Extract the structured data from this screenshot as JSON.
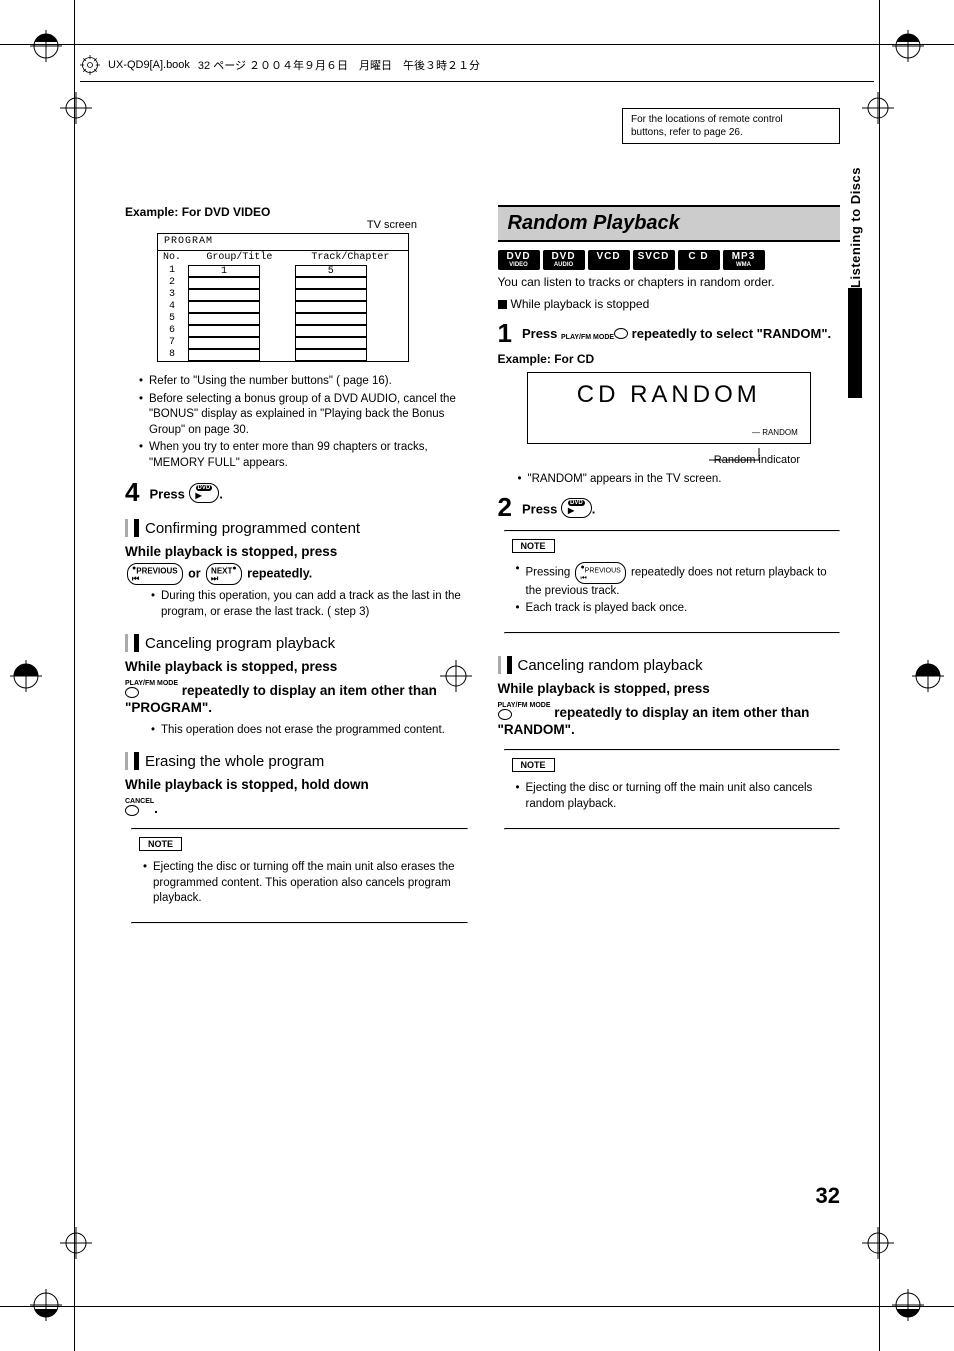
{
  "book_header": {
    "filename": "UX-QD9[A].book",
    "page_text": "32 ページ ２００４年９月６日　月曜日　午後３時２１分"
  },
  "ref_box": {
    "line1": "For the locations of remote control",
    "line2": "buttons, refer to page 26."
  },
  "side_tab": "Listening to Discs",
  "left": {
    "example_label": "Example: For DVD VIDEO",
    "tv_screen": "TV screen",
    "program_title": "PROGRAM",
    "cols": {
      "no": "No.",
      "group": "Group/Title",
      "track": "Track/Chapter"
    },
    "first_group": "1",
    "first_track": "5",
    "rows": [
      "1",
      "2",
      "3",
      "4",
      "5",
      "6",
      "7",
      "8"
    ],
    "bullets": [
      "Refer to \"Using the number buttons\" (       page 16).",
      "Before selecting a bonus group of a DVD AUDIO, cancel the \"BONUS\" display as explained in \"Playing back the Bonus Group\" on page 30.",
      "When you try to enter more than 99 chapters or tracks, \"MEMORY FULL\" appears."
    ],
    "step4": {
      "num": "4",
      "text_a": "Press ",
      "text_b": "."
    },
    "confirm_heading": "Confirming programmed content",
    "confirm_line1": "While playback is stopped, press",
    "confirm_line2a": " or ",
    "confirm_line2b": " repeatedly.",
    "confirm_sub": "During this operation, you can add a track as the last in the program, or erase the last track. (       step 3)",
    "cancel_heading": "Canceling program playback",
    "cancel_line1": "While playback is stopped, press",
    "cancel_line2": " repeatedly to display an item other than \"PROGRAM\".",
    "cancel_sub": "This operation does not erase the programmed content.",
    "erase_heading": "Erasing the whole program",
    "erase_line1": "While playback is stopped, hold down",
    "erase_line2": ".",
    "note1": "Ejecting the disc or turning off the main unit also erases the programmed content. This operation also cancels program playback.",
    "icons": {
      "dvd_play": "DVD",
      "previous": "PREVIOUS",
      "next": "NEXT",
      "playfmmode": "PLAY/FM MODE",
      "cancel": "CANCEL"
    }
  },
  "right": {
    "h2": "Random Playback",
    "formats": [
      {
        "main": "DVD",
        "sub": "VIDEO"
      },
      {
        "main": "DVD",
        "sub": "AUDIO"
      },
      {
        "main": "VCD",
        "sub": ""
      },
      {
        "main": "SVCD",
        "sub": ""
      },
      {
        "main": "C D",
        "sub": ""
      },
      {
        "main": "MP3",
        "sub": "WMA"
      }
    ],
    "intro": "You can listen to tracks or chapters in random order.",
    "while_stopped": "While playback is stopped",
    "step1": {
      "num": "1",
      "a": "Press ",
      "b": " repeatedly to select \"RANDOM\"."
    },
    "example_label": "Example: For CD",
    "cd_panel": "CD RANDOM",
    "random_small": "RANDOM",
    "random_indicator": "Random indicator",
    "random_tv": "\"RANDOM\" appears in the TV screen.",
    "step2": {
      "num": "2",
      "a": "Press ",
      "b": "."
    },
    "note2a": "Pressing        repeatedly does not return playback to the previous track.",
    "note2b": "Each track is played back once.",
    "cancel_heading": "Canceling random playback",
    "cancel_line1": "While playback is stopped, press",
    "cancel_line2": " repeatedly to display an item other than \"RANDOM\".",
    "note3": "Ejecting the disc or turning off the main unit also cancels random playback.",
    "note_label": "NOTE",
    "icons": {
      "playfmmode": "PLAY/FM MODE",
      "dvd_play": "DVD",
      "previous": "PREVIOUS"
    }
  },
  "page_number": "32"
}
